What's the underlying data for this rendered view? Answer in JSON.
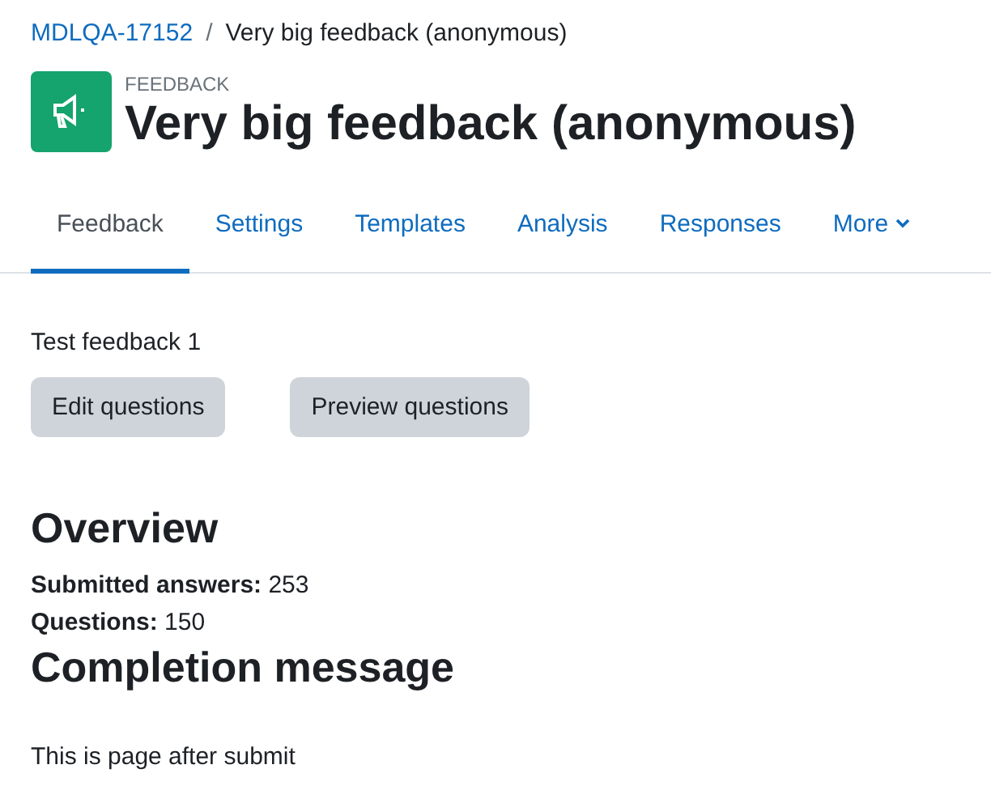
{
  "breadcrumb": [
    {
      "label": "MDLQA-17152",
      "kind": "link"
    },
    {
      "label": "Very big feedback (anonymous)",
      "kind": "current"
    }
  ],
  "breadcrumb_separator": "/",
  "header": {
    "category": "FEEDBACK",
    "title": "Very big feedback (anonymous)"
  },
  "tabs": [
    {
      "label": "Feedback",
      "selected": true,
      "kind": "tab"
    },
    {
      "label": "Settings",
      "selected": false,
      "kind": "tab"
    },
    {
      "label": "Templates",
      "selected": false,
      "kind": "tab"
    },
    {
      "label": "Analysis",
      "selected": false,
      "kind": "tab"
    },
    {
      "label": "Responses",
      "selected": false,
      "kind": "tab"
    },
    {
      "label": "More",
      "selected": false,
      "kind": "menu"
    }
  ],
  "intro": "Test feedback 1",
  "buttons": [
    "Edit questions",
    "Preview questions"
  ],
  "overview": {
    "heading": "Overview",
    "lines": [
      "**Submitted answers:** 253",
      "**Questions:** 150"
    ]
  },
  "completion": {
    "heading": "Completion message",
    "text": "This is page after submit"
  }
}
